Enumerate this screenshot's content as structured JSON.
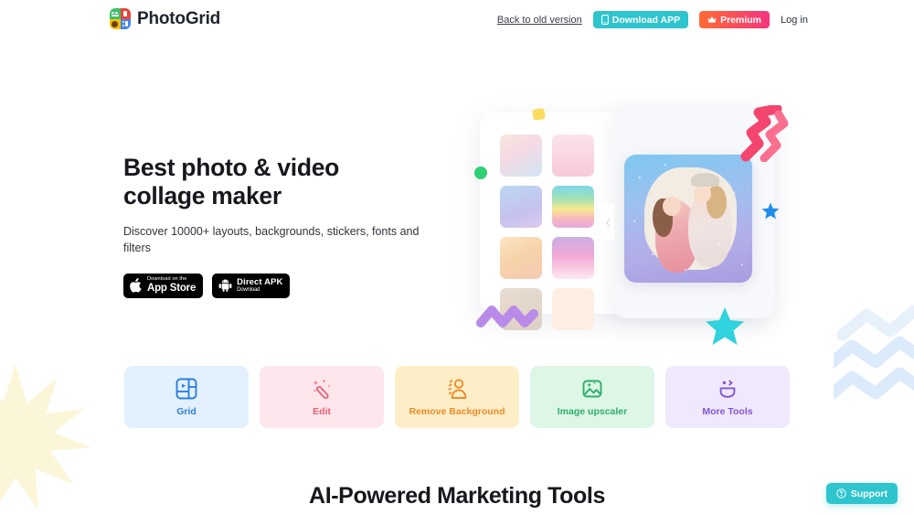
{
  "brand": {
    "name": "PhotoGrid",
    "logo_icon": "photogrid-logo-icon"
  },
  "header": {
    "back_to_old": "Back to old version",
    "download_app": "Download APP",
    "download_app_icon": "phone-icon",
    "premium": "Premium",
    "premium_icon": "crown-icon",
    "login": "Log in"
  },
  "hero": {
    "title": "Best photo & video collage maker",
    "subtitle": "Discover 10000+ layouts, backgrounds, stickers, fonts and filters",
    "app_store": {
      "top": "Download on the",
      "bottom": "App Store",
      "icon": "apple-icon"
    },
    "apk": {
      "top": "Direct APK",
      "bottom": "Download",
      "icon": "android-icon"
    }
  },
  "illustration": {
    "collapse_icon": "chevron-left-icon",
    "thumbnails": [
      "background-thumb-confetti",
      "background-thumb-pink-blossom",
      "background-thumb-blue-purple-glitter",
      "background-thumb-rainbow",
      "background-thumb-peach-cream",
      "background-thumb-pink-drip",
      "background-thumb-beige-sand",
      "background-thumb-lips-pattern"
    ],
    "preview": "photo-preview-two-women-glitter",
    "decorations": [
      "yellow-square-deco",
      "green-circle-deco",
      "pink-zigzag-deco",
      "blue-star-deco",
      "teal-star-deco",
      "purple-zigzag-deco"
    ]
  },
  "tools": [
    {
      "label": "Grid",
      "icon": "grid-layout-icon",
      "key": "grid",
      "color": "#2b7fe0",
      "bg": "#e3f0fd"
    },
    {
      "label": "Edit",
      "icon": "magic-wand-icon",
      "key": "edit",
      "color": "#ef5e73",
      "bg": "#fde7ec"
    },
    {
      "label": "Remove Background",
      "icon": "person-cutout-icon",
      "key": "rbg",
      "color": "#ef8b2c",
      "bg": "#fdeec7"
    },
    {
      "label": "Image upscaler",
      "icon": "image-sparkle-icon",
      "key": "ups",
      "color": "#2eaf6a",
      "bg": "#ddf6e6"
    },
    {
      "label": "More Tools",
      "icon": "smiley-face-icon",
      "key": "more",
      "color": "#8254d6",
      "bg": "#f0e8fc"
    }
  ],
  "section": {
    "title": "AI-Powered Marketing Tools"
  },
  "support": {
    "label": "Support",
    "icon": "question-circle-icon"
  },
  "page_decor": {
    "sunburst": "yellow-sunburst-deco",
    "blue_zigzag": "blue-zigzag-deco"
  }
}
